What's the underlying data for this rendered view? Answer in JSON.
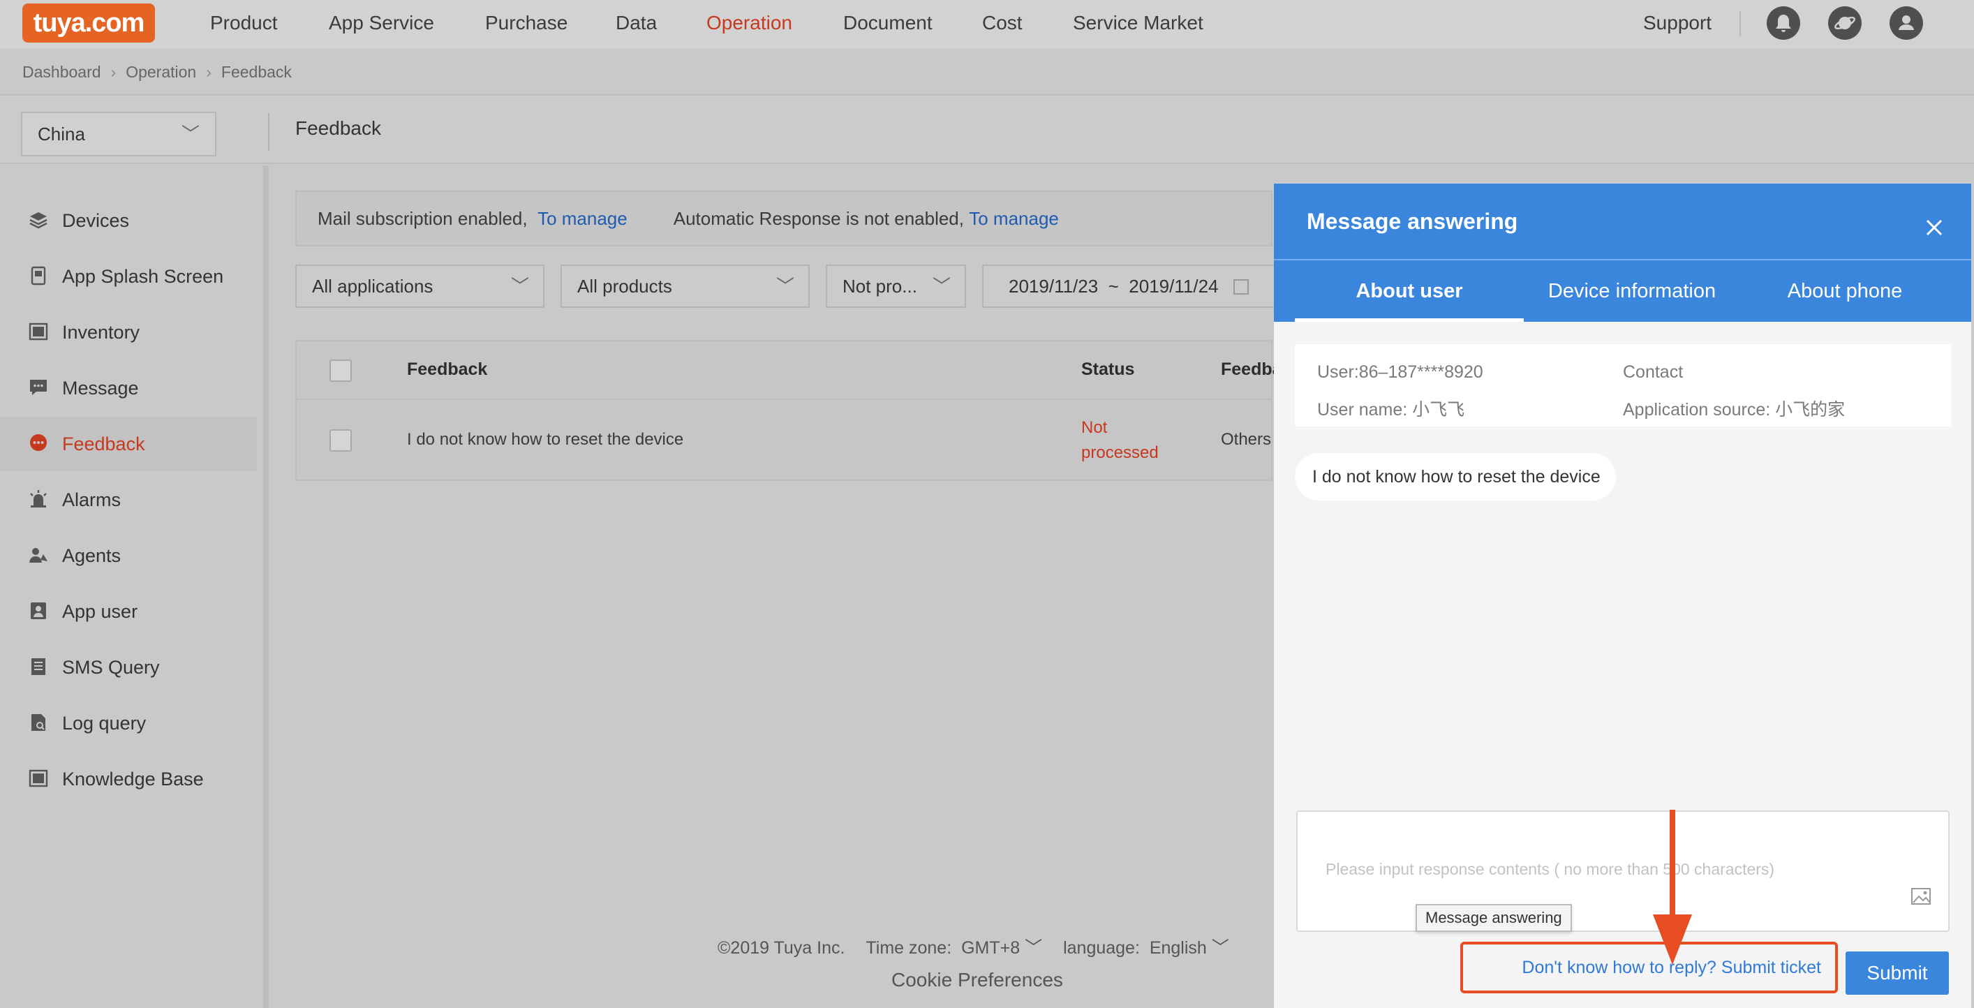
{
  "brand": {
    "logo_text": "tuya.com",
    "logo_color": "#e56424"
  },
  "topnav": {
    "items": [
      "Product",
      "App Service",
      "Purchase",
      "Data",
      "Operation",
      "Document",
      "Cost",
      "Service Market"
    ],
    "active": "Operation",
    "support_label": "Support",
    "icons": [
      "bell-icon",
      "planet-icon",
      "user-avatar-icon"
    ]
  },
  "breadcrumb": [
    "Dashboard",
    "Operation",
    "Feedback"
  ],
  "subheader": {
    "region": "China",
    "page_title": "Feedback"
  },
  "sidebar": {
    "items": [
      {
        "label": "Devices",
        "icon": "layers-icon"
      },
      {
        "label": "App Splash Screen",
        "icon": "splash-screen-icon"
      },
      {
        "label": "Inventory",
        "icon": "inventory-icon"
      },
      {
        "label": "Message",
        "icon": "message-icon"
      },
      {
        "label": "Feedback",
        "icon": "feedback-icon"
      },
      {
        "label": "Alarms",
        "icon": "alarm-icon"
      },
      {
        "label": "Agents",
        "icon": "agents-icon"
      },
      {
        "label": "App user",
        "icon": "app-user-icon"
      },
      {
        "label": "SMS Query",
        "icon": "sms-icon"
      },
      {
        "label": "Log query",
        "icon": "log-query-icon"
      },
      {
        "label": "Knowledge Base",
        "icon": "knowledge-base-icon"
      }
    ],
    "active": "Feedback"
  },
  "notice": {
    "mail_text": "Mail subscription enabled,",
    "mail_link": "To manage",
    "auto_text": "Automatic Response is not enabled,",
    "auto_link": "To manage"
  },
  "filters": {
    "applications": "All applications",
    "products": "All products",
    "status": "Not pro...",
    "date_start": "2019/11/23",
    "date_sep": "~",
    "date_end": "2019/11/24"
  },
  "table": {
    "headers": [
      "Feedback",
      "Status",
      "Feedba"
    ],
    "rows": [
      {
        "feedback": "I do not know how to reset the device",
        "status": "Not processed",
        "type": "Others"
      }
    ]
  },
  "footer": {
    "copyright": "©2019 Tuya Inc.",
    "timezone_label": "Time zone:",
    "timezone_value": "GMT+8",
    "language_label": "language:",
    "language_value": "English",
    "cookie": "Cookie Preferences"
  },
  "panel": {
    "title": "Message answering",
    "tabs": [
      "About user",
      "Device information",
      "About phone"
    ],
    "active_tab": "About user",
    "user": {
      "id_line": "User:86–187****8920",
      "contact_line": "Contact",
      "name_line": "User name: 小飞飞",
      "source_line": "Application source: 小飞的家"
    },
    "message": "I do not know how to reset the device",
    "reply_placeholder": "Please input response contents ( no more than 500 characters)",
    "tooltip": "Message answering",
    "ticket_link": "Don't know how to reply? Submit ticket",
    "submit_label": "Submit"
  },
  "colors": {
    "primary_blue": "#3a86dc",
    "active_red": "#c6391f",
    "annotation_red": "#e84c22",
    "link_blue": "#1f5bb0"
  }
}
